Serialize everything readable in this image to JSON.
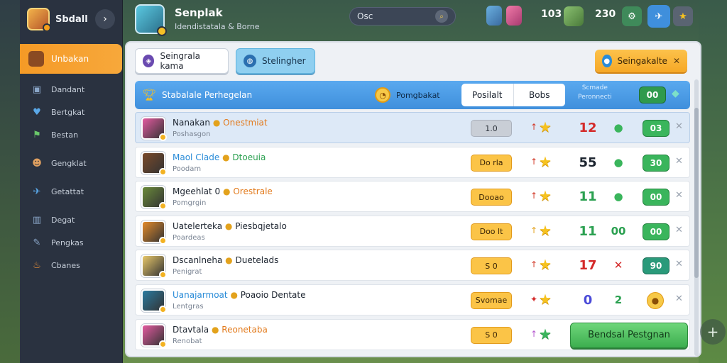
{
  "sidebar": {
    "title": "Sbdall",
    "active_item": "Unbakan",
    "items": [
      {
        "label": "Dandant",
        "icon": "user-icon"
      },
      {
        "label": "Bertgkat",
        "icon": "heart-icon"
      },
      {
        "label": "Bestan",
        "icon": "flag-icon"
      },
      {
        "label": "Gengklat",
        "icon": "character-icon"
      },
      {
        "label": "Getattat",
        "icon": "bird-icon"
      },
      {
        "label": "Degat",
        "icon": "chart-icon"
      },
      {
        "label": "Pengkas",
        "icon": "pencil-icon"
      },
      {
        "label": "Cbanes",
        "icon": "flame-icon"
      }
    ]
  },
  "topbar": {
    "player_name": "Senplak",
    "player_sub": "Idendistatala & Borne",
    "search_value": "Osc",
    "stat_a": "103",
    "stat_b": "230",
    "colors": {
      "accent_blue": "#3f8fdc",
      "accent_orange": "#f6a826",
      "accent_green": "#3ab55c"
    }
  },
  "panel": {
    "tab1_label": "Seingrala kama",
    "tab2_label": "Stelingher",
    "action_button": "Seingakalte",
    "header": {
      "title": "Stabalale Perhegelan",
      "coin_label": "Pomgbakat",
      "segment_left": "Posilalt",
      "segment_right": "Bobs",
      "right_label_1": "Scmade",
      "right_label_2": "Peronnecti",
      "pill": "00"
    },
    "rows": [
      {
        "name": "Nanakan",
        "tag": "Onestmiat",
        "tag_color": "#e27a1c",
        "sub": "Poshasgon",
        "score": "1.0",
        "score_gray": true,
        "arrow": "↑",
        "arrow_color": "#d23a2a",
        "num": "12",
        "num_color": "#d42a2a",
        "mark": "●",
        "mark_color": "#3ab55c",
        "pill": "03",
        "avatar": "#e35aa0"
      },
      {
        "name": "Maol Clade",
        "tag": "Dtoeuia",
        "tag_color": "#2aa050",
        "name_color": "#2a8cd8",
        "sub": "Poodam",
        "score": "Do rla",
        "score_gray": false,
        "arrow": "↑",
        "arrow_color": "#d23a2a",
        "num": "55",
        "num_color": "#1d2530",
        "mark": "●",
        "mark_color": "#3ab55c",
        "pill": "30",
        "avatar": "#7a4a2a"
      },
      {
        "name": "Mgeehlat 0",
        "tag": "Orestrale",
        "tag_color": "#e27a1c",
        "sub": "Pomgrgin",
        "score": "Dooao",
        "score_gray": false,
        "arrow": "↑",
        "arrow_color": "#d23a2a",
        "num": "11",
        "num_color": "#2aa050",
        "mark": "●",
        "mark_color": "#3ab55c",
        "pill": "00",
        "avatar": "#6a8a3a"
      },
      {
        "name": "Uatelerteka",
        "tag": "Piesbqjetalo",
        "tag_color": "#1d2530",
        "sub": "Poardeas",
        "score": "Doo lt",
        "score_gray": false,
        "arrow": "↑",
        "arrow_color": "#e3a21c",
        "num": "11",
        "num_color": "#2aa050",
        "mark": "00",
        "mark_color": "#2aa050",
        "pill": "00",
        "avatar": "#e38a2a"
      },
      {
        "name": "Dscanlneha",
        "tag": "Duetelads",
        "tag_color": "#1d2530",
        "sub": "Penigrat",
        "score": "S 0",
        "score_gray": false,
        "arrow": "↑",
        "arrow_color": "#d23a2a",
        "num": "17",
        "num_color": "#d42a2a",
        "mark": "✕",
        "mark_color": "#d42a2a",
        "pill": "90",
        "avatar": "#e8c86a"
      },
      {
        "name": "Uanajarmoat",
        "tag": "Poaoio Dentate",
        "tag_color": "#1d2530",
        "name_color": "#2a8cd8",
        "sub": "Lentgras",
        "score": "Svomae",
        "score_gray": false,
        "arrow": "✦",
        "arrow_color": "#d42a2a",
        "num": "0",
        "num_color": "#4a4ad8",
        "mark": "2",
        "mark_color": "#2aa050",
        "pill": "",
        "avatar": "#2a7aa0"
      },
      {
        "name": "Dtavtala",
        "tag": "Reonetaba",
        "tag_color": "#e27a1c",
        "sub": "Renobat",
        "score": "S 0",
        "score_gray": false,
        "arrow": "↑",
        "arrow_color": "#b55ad0",
        "num": "",
        "num_color": "#1d2530",
        "mark": "",
        "mark_color": "#1d2530",
        "pill": "",
        "avatar": "#e35aa0"
      }
    ],
    "cta_label": "Bendsal Pestgnan"
  }
}
